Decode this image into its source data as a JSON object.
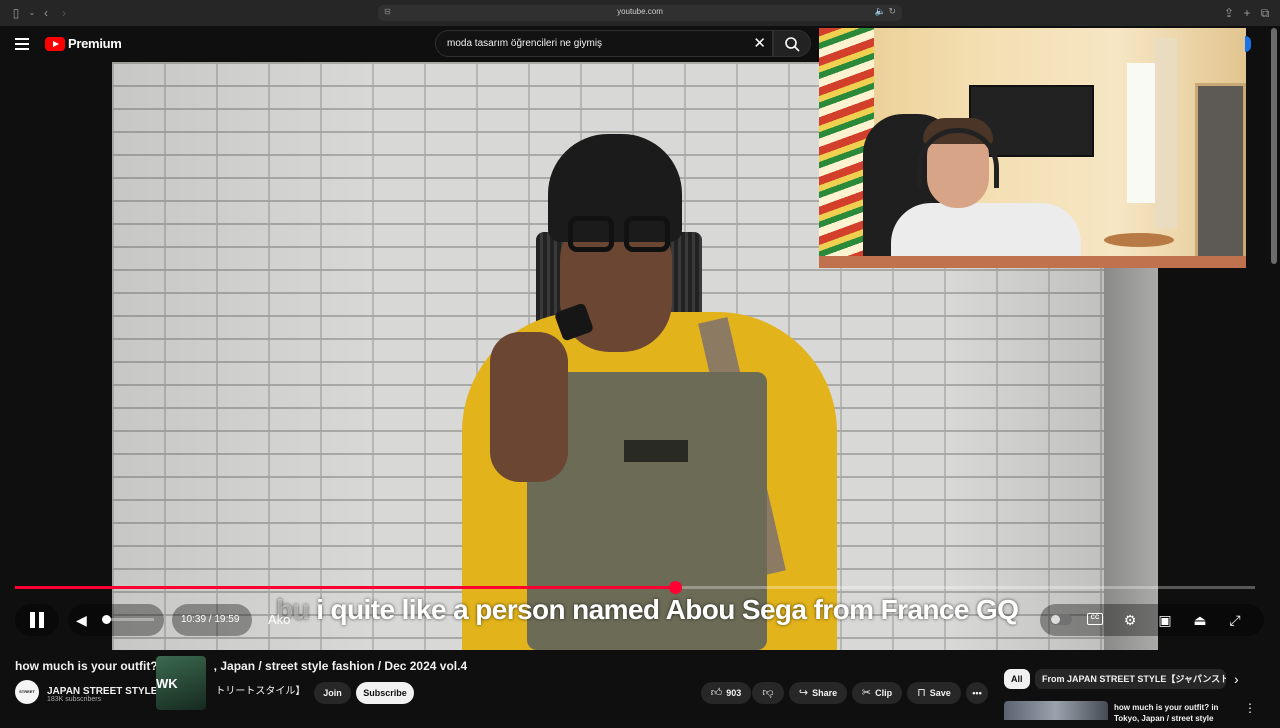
{
  "browser": {
    "url": "youtube.com"
  },
  "header": {
    "logo_text": "Premium",
    "search_query": "moda tasarım öğrencileri ne giymiş"
  },
  "player": {
    "caption_dim": "bu",
    "caption_text": " i quite like a person named Abou Sega from France GQ",
    "current_time": "10:39",
    "duration": "19:59",
    "time_display": "10:39 / 19:59",
    "chapter_label": "Ako",
    "progress_fraction": 0.532,
    "accent_color": "#ff0033"
  },
  "video": {
    "title": "how much is your outfit? in Tokyo, Japan / street style fashion / Dec 2024 vol.4",
    "title_visible_left": "how much is your outfit?",
    "title_visible_right": ", Japan / street style fashion / Dec 2024 vol.4",
    "channel_name": "JAPAN STREET STYLE",
    "channel_suffix": "トリートスタイル】",
    "avatar_text": "STREET STYLE",
    "overlay_text": "WK",
    "subscribers": "183K subscribers",
    "join_label": "Join",
    "subscribe_label": "Subscribe",
    "like_count": "903",
    "share_label": "Share",
    "clip_label": "Clip",
    "save_label": "Save"
  },
  "sidebar": {
    "chips": [
      "All",
      "From JAPAN STREET STYLE【ジャパンストリ"
    ],
    "rec_title": "how much is your outfit? in Tokyo, Japan / street style"
  }
}
